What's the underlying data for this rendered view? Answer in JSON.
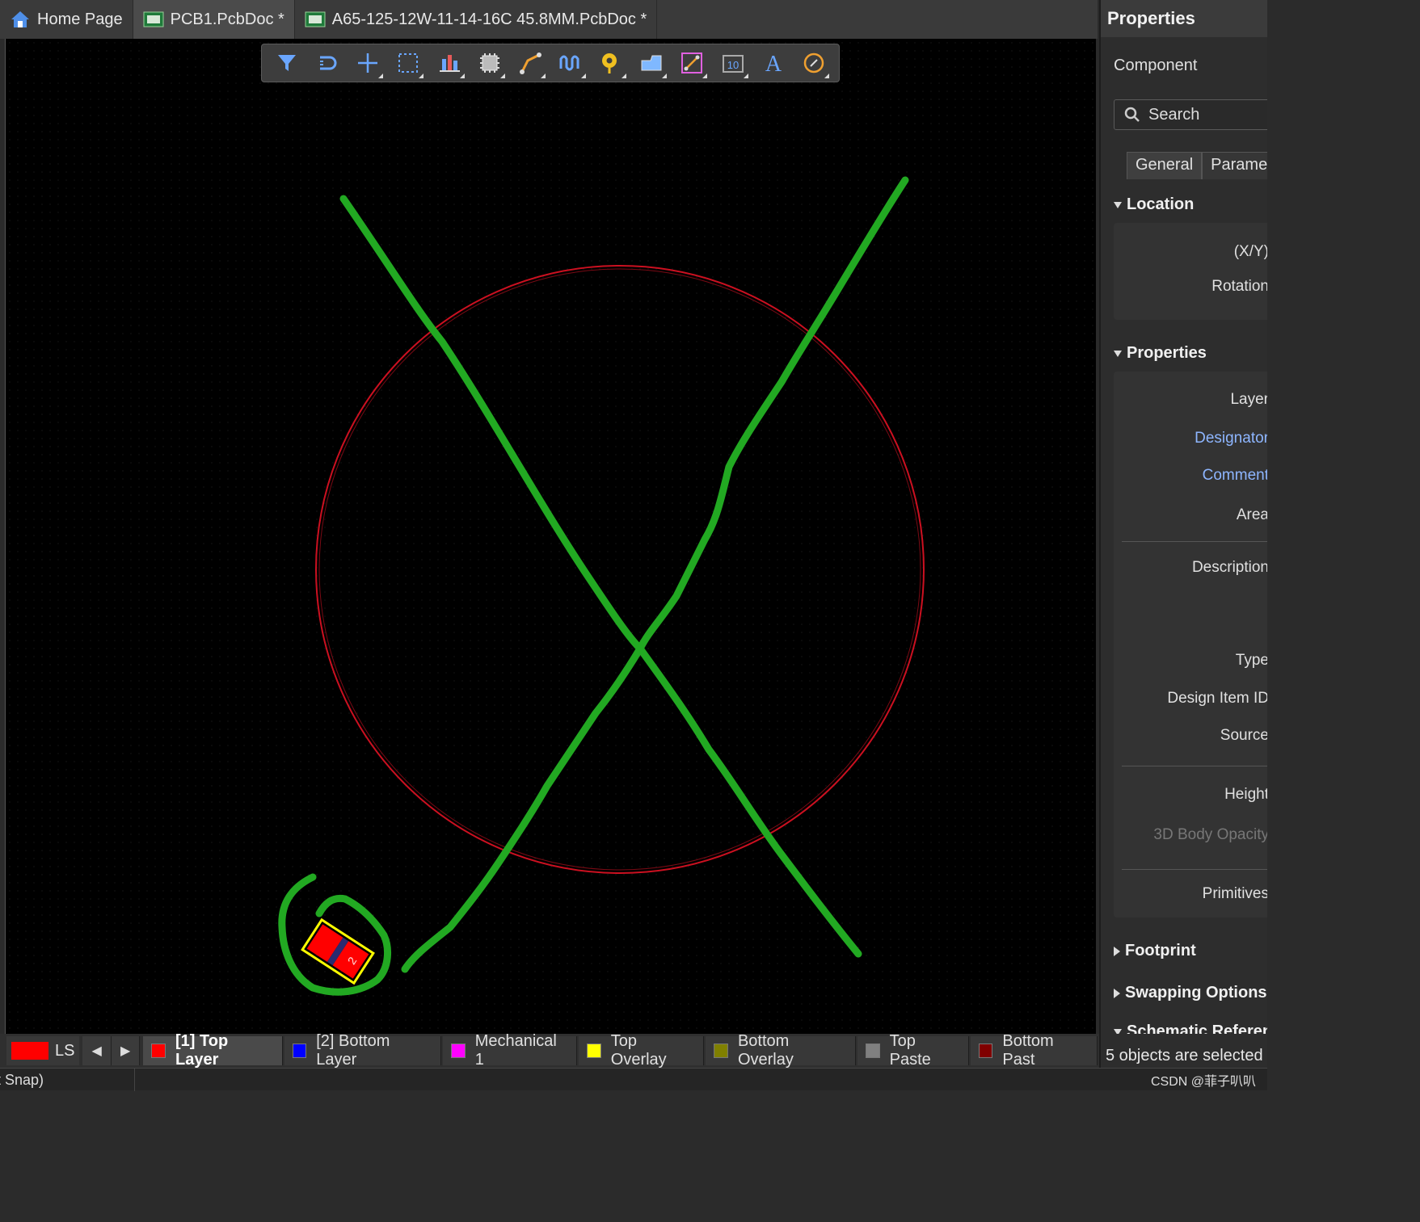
{
  "tabs": [
    {
      "label": "Home Page",
      "icon": "home-icon"
    },
    {
      "label": "PCB1.PcbDoc *",
      "icon": "pcb-doc-icon"
    },
    {
      "label": "A65-125-12W-11-14-16C 45.8MM.PcbDoc *",
      "icon": "pcb-doc-icon"
    }
  ],
  "toolbar": {
    "tools": [
      "filter-icon",
      "interactive-routing-icon",
      "move-icon",
      "select-area-icon",
      "align-icon",
      "component-icon",
      "route-icon",
      "tune-length-icon",
      "pad-via-icon",
      "polygon-icon",
      "dimension-icon",
      "string-10-icon",
      "text-icon",
      "arc-icon"
    ],
    "text_tool_glyph": "A",
    "string_tool_glyph": "10"
  },
  "component": {
    "pad_label": "2"
  },
  "layers": {
    "ls_label": "LS",
    "items": [
      {
        "label": "[1] Top Layer",
        "color": "#ff0000",
        "active": true
      },
      {
        "label": "[2] Bottom Layer",
        "color": "#0000ff"
      },
      {
        "label": "Mechanical 1",
        "color": "#ff00ff"
      },
      {
        "label": "Top Overlay",
        "color": "#ffff00"
      },
      {
        "label": "Bottom Overlay",
        "color": "#808000"
      },
      {
        "label": "Top Paste",
        "color": "#808080"
      },
      {
        "label": "Bottom Past",
        "color": "#800000"
      }
    ]
  },
  "status": {
    "left_text": "t Snap)",
    "watermark": "CSDN @菲子叭叭"
  },
  "properties": {
    "title": "Properties",
    "subtitle": "Component",
    "search_placeholder": "Search",
    "tabs": [
      "General",
      "Paramete"
    ],
    "location": {
      "header": "Location",
      "labels": [
        "(X/Y)",
        "Rotation"
      ]
    },
    "props": {
      "header": "Properties",
      "group1": [
        "Layer",
        "Designator",
        "Comment",
        "Area"
      ],
      "group2": [
        "Description"
      ],
      "group3": [
        "Type",
        "Design Item ID",
        "Source"
      ],
      "group4": [
        "Height",
        "3D Body Opacity"
      ],
      "group5": [
        "Primitives"
      ]
    },
    "footprint": "Footprint",
    "swapping": "Swapping Options",
    "schematic": "Schematic Referenc",
    "selected": "5 objects are selected"
  },
  "colors": {
    "trace": "#22a922",
    "outline": "#cc1020",
    "pad": "#ff0000",
    "overlay": "#ffff00"
  }
}
